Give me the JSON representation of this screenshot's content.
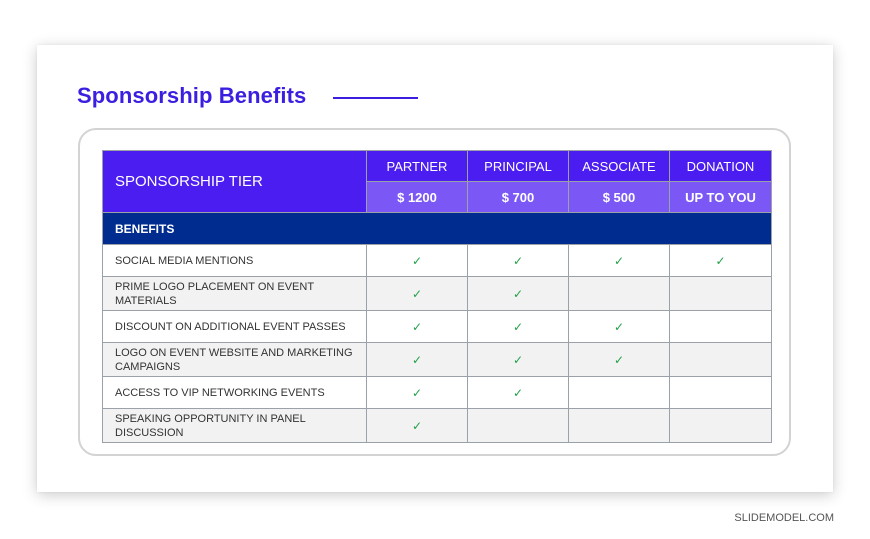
{
  "slide": {
    "title": "Sponsorship Benefits"
  },
  "table": {
    "tier_header": "SPONSORSHIP TIER",
    "benefits_header": "BENEFITS",
    "tiers": [
      {
        "name": "PARTNER",
        "price": "$ 1200"
      },
      {
        "name": "PRINCIPAL",
        "price": "$ 700"
      },
      {
        "name": "ASSOCIATE",
        "price": "$ 500"
      },
      {
        "name": "DONATION",
        "price": "UP TO YOU"
      }
    ],
    "check_symbol": "✓",
    "check_color": "#21a04a",
    "rows": [
      {
        "label": "SOCIAL MEDIA MENTIONS",
        "checks": [
          true,
          true,
          true,
          true
        ]
      },
      {
        "label": "PRIME LOGO PLACEMENT ON EVENT MATERIALS",
        "checks": [
          true,
          true,
          false,
          false
        ]
      },
      {
        "label": "DISCOUNT ON ADDITIONAL EVENT PASSES",
        "checks": [
          true,
          true,
          true,
          false
        ]
      },
      {
        "label": "LOGO ON EVENT WEBSITE AND MARKETING CAMPAIGNS",
        "checks": [
          true,
          true,
          true,
          false
        ]
      },
      {
        "label": "ACCESS TO VIP NETWORKING EVENTS",
        "checks": [
          true,
          true,
          false,
          false
        ]
      },
      {
        "label": "SPEAKING OPPORTUNITY IN PANEL DISCUSSION",
        "checks": [
          true,
          false,
          false,
          false
        ]
      }
    ]
  },
  "footer": {
    "brand": "SLIDEMODEL.COM"
  },
  "colors": {
    "title": "#3a1fe0",
    "header_dark": "#4b1df0",
    "header_light": "#7b58f5",
    "benefits_bar": "#002b8f"
  }
}
